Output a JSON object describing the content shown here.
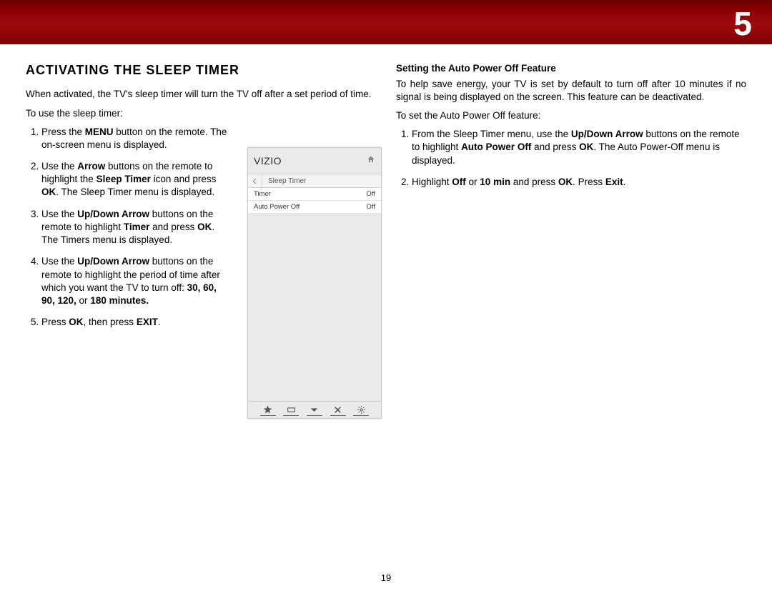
{
  "header": {
    "chapter_number": "5"
  },
  "page_number": "19",
  "left_col": {
    "section_heading": "ACTIVATING THE SLEEP TIMER",
    "intro": "When activated, the TV's sleep timer will turn the TV off after a set period of time.",
    "leadin": "To use the sleep timer:",
    "steps": [
      {
        "pre": "Press the ",
        "b1": "MENU",
        "mid": " button on the remote. The on-screen menu is displayed."
      },
      {
        "pre": "Use the ",
        "b1": "Arrow",
        "mid": " buttons on the remote to highlight the ",
        "b2": "Sleep Timer",
        "mid2": " icon and press ",
        "b3": "OK",
        "tail": ". The Sleep Timer menu is displayed."
      },
      {
        "pre": "Use the ",
        "b1": "Up/Down Arrow",
        "mid": " buttons on the remote to highlight ",
        "b2": "Timer",
        "mid2": " and press ",
        "b3": "OK",
        "tail": ". The Timers menu is displayed."
      },
      {
        "pre": "Use the ",
        "b1": "Up/Down Arrow",
        "mid": " buttons on the remote to highlight the period of time after which you want the TV to turn off: ",
        "b2": "30, 60, 90, 120,",
        "mid2": " or ",
        "b3": "180 minutes."
      },
      {
        "pre": "Press ",
        "b1": "OK",
        "mid": ", then press ",
        "b2": "EXIT",
        "tail": "."
      }
    ]
  },
  "right_col": {
    "sub_heading": "Setting the Auto Power Off Feature",
    "intro": "To help save energy, your TV is set by default to turn off after 10 minutes if no signal is being displayed on the screen. This feature can be deactivated.",
    "leadin": "To set the Auto Power Off feature:",
    "steps": [
      {
        "pre": "From the Sleep Timer menu, use the ",
        "b1": "Up/Down Arrow",
        "mid": " buttons on the remote to highlight ",
        "b2": "Auto Power Off",
        "mid2": " and press ",
        "b3": "OK",
        "tail": ". The Auto Power-Off menu is displayed."
      },
      {
        "pre": "Highlight ",
        "b1": "Off",
        "mid": " or ",
        "b2": "10 min",
        "mid2": " and press ",
        "b3": "OK",
        "mid3": ". Press ",
        "b4": "Exit",
        "tail": "."
      }
    ]
  },
  "menu_shot": {
    "brand": "VIZIO",
    "crumb": "Sleep Timer",
    "rows": [
      {
        "label": "Timer",
        "value": "Off"
      },
      {
        "label": "Auto Power Off",
        "value": "Off"
      }
    ],
    "bottom_icons": [
      "star-icon",
      "wide-icon",
      "down-chevron-icon",
      "close-icon",
      "gear-icon"
    ]
  }
}
